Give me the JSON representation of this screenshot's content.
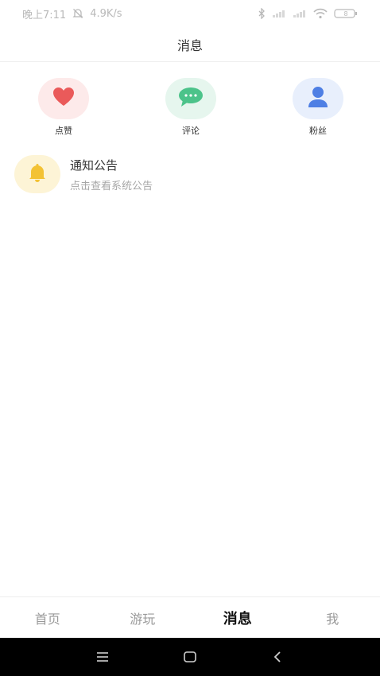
{
  "status_bar": {
    "time": "晚上7:11",
    "speed": "4.9K/s",
    "battery": "8"
  },
  "header": {
    "title": "消息"
  },
  "quick_actions": [
    {
      "label": "点赞",
      "icon": "heart-icon",
      "bg": "#fdeaea",
      "color": "#ea5a5a"
    },
    {
      "label": "评论",
      "icon": "chat-bubble-icon",
      "bg": "#e6f6ee",
      "color": "#4cc38a"
    },
    {
      "label": "粉丝",
      "icon": "person-icon",
      "bg": "#e8effc",
      "color": "#4e7fe4"
    }
  ],
  "notice": {
    "title": "通知公告",
    "subtitle": "点击查看系统公告",
    "icon": "bell-icon",
    "bg": "#fdf4d6",
    "color": "#f3c234"
  },
  "tabs": [
    {
      "label": "首页",
      "active": false
    },
    {
      "label": "游玩",
      "active": false
    },
    {
      "label": "消息",
      "active": true
    },
    {
      "label": "我",
      "active": false
    }
  ],
  "system_nav": [
    "menu-icon",
    "home-icon",
    "back-icon"
  ]
}
